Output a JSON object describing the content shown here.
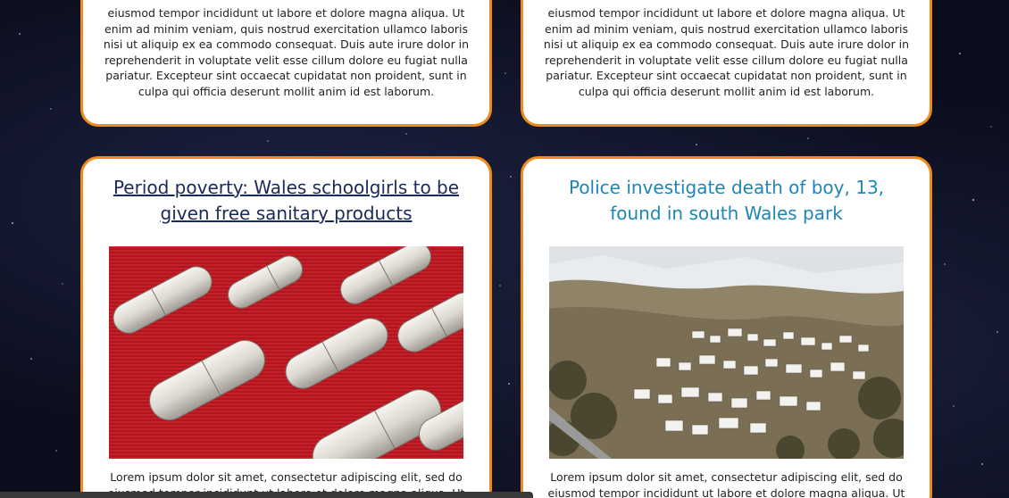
{
  "top_cards": [
    {
      "body": "eiusmod tempor incididunt ut labore et dolore magna aliqua. Ut enim ad minim veniam, quis nostrud exercitation ullamco laboris nisi ut aliquip ex ea commodo consequat. Duis aute irure dolor in reprehenderit in voluptate velit esse cillum dolore eu fugiat nulla pariatur. Excepteur sint occaecat cupidatat non proident, sunt in culpa qui officia deserunt mollit anim id est laborum."
    },
    {
      "body": "eiusmod tempor incididunt ut labore et dolore magna aliqua. Ut enim ad minim veniam, quis nostrud exercitation ullamco laboris nisi ut aliquip ex ea commodo consequat. Duis aute irure dolor in reprehenderit in voluptate velit esse cillum dolore eu fugiat nulla pariatur. Excepteur sint occaecat cupidatat non proident, sunt in culpa qui officia deserunt mollit anim id est laborum."
    }
  ],
  "articles": [
    {
      "headline": "Period poverty: Wales schoolgirls to be given free sanitary products",
      "image": "tampons-on-red-fabric-photo",
      "body": "Lorem ipsum dolor sit amet, consectetur adipiscing elit, sed do eiusmod tempor incididunt ut labore et dolore magna aliqua. Ut"
    },
    {
      "headline": "Police investigate death of boy, 13, found in south Wales park",
      "image": "snowy-welsh-valley-town-photo",
      "body": "Lorem ipsum dolor sit amet, consectetur adipiscing elit, sed do eiusmod tempor incididunt ut labore et dolore magna aliqua. Ut"
    }
  ],
  "colors": {
    "card_border": "#f08a1c",
    "visited_link": "#1a2a5a",
    "link": "#1f86b4",
    "background": "#0b0d1c"
  }
}
